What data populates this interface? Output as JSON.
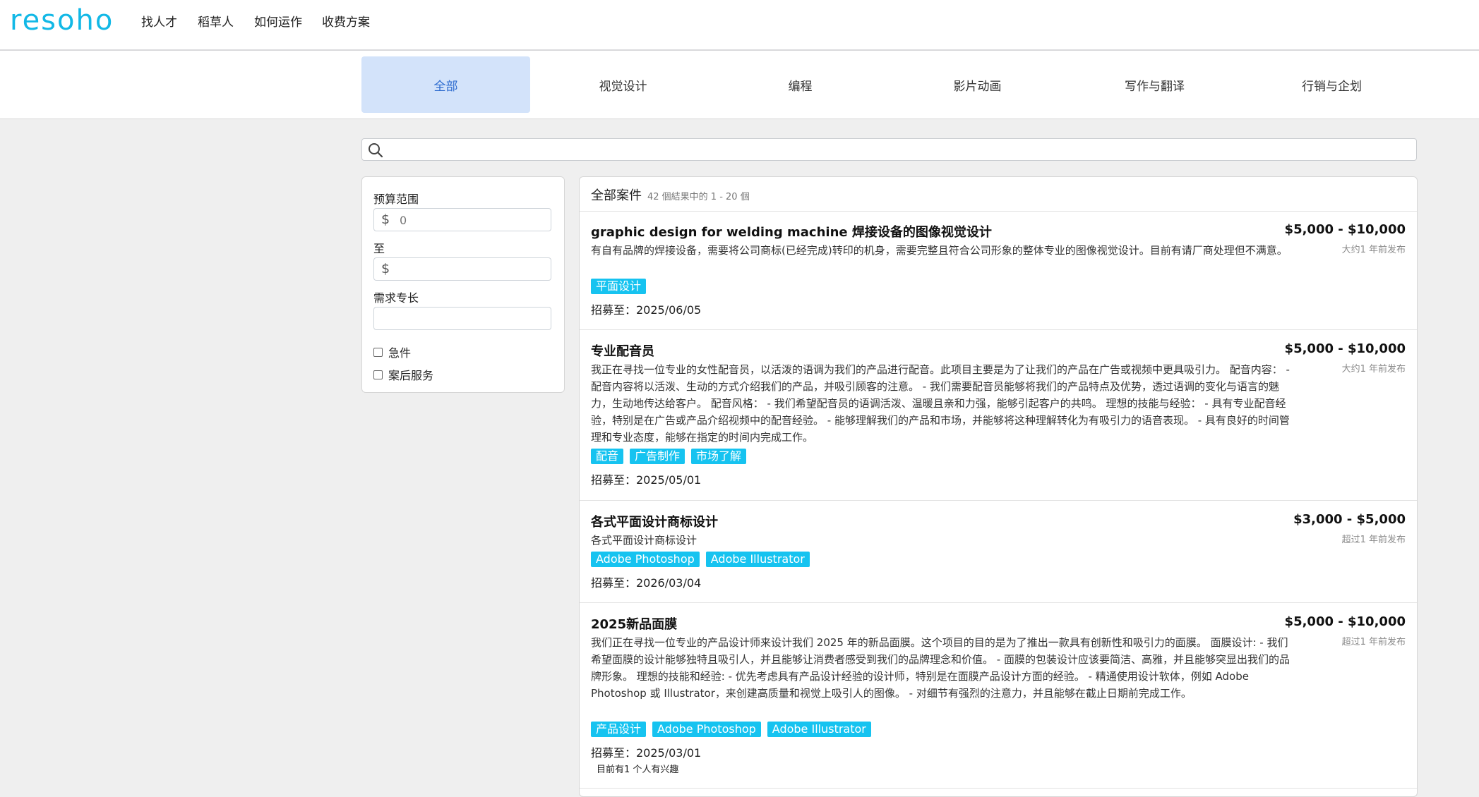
{
  "nav": {
    "logo": "resoho",
    "links": [
      "找人才",
      "稻草人",
      "如何运作",
      "收费方案"
    ]
  },
  "categories": [
    "全部",
    "视觉设计",
    "编程",
    "影片动画",
    "写作与翻译",
    "行销与企划"
  ],
  "search": {
    "placeholder": "",
    "value": ""
  },
  "filter": {
    "budget_label": "预算范围",
    "min_placeholder": "0",
    "to_label": "至",
    "max_placeholder": "",
    "skill_label": "需求专长",
    "skill_value": "",
    "urgent_label": "急件",
    "aftersale_label": "案后服务"
  },
  "results": {
    "title": "全部案件",
    "count_text": "42 個結果中的 1 - 20 個",
    "items": [
      {
        "title": "graphic design for welding machine 焊接设备的图像视觉设计",
        "description": "有自有品牌的焊接设备，需要将公司商标(已经完成)转印的机身，需要完整且符合公司形象的整体专业的图像视觉设计。目前有请厂商处理但不满意。",
        "tags": [
          "平面设计"
        ],
        "deadline": "招募至：2025/06/05",
        "price": "$5,000 - $10,000",
        "posted": "大约1 年前发布",
        "interest": ""
      },
      {
        "title": "专业配音员",
        "description": "我正在寻找一位专业的女性配音员，以活泼的语调为我们的产品进行配音。此项目主要是为了让我们的产品在广告或视频中更具吸引力。 配音内容： - 配音内容将以活泼、生动的方式介绍我们的产品，并吸引顾客的注意。 - 我们需要配音员能够将我们的产品特点及优势，透过语调的变化与语言的魅力，生动地传达给客户。 配音风格： - 我们希望配音员的语调活泼、温暖且亲和力强，能够引起客户的共鸣。 理想的技能与经验： - 具有专业配音经验，特别是在广告或产品介绍视频中的配音经验。 - 能够理解我们的产品和市场，并能够将这种理解转化为有吸引力的语音表现。 - 具有良好的时间管理和专业态度，能够在指定的时间内完成工作。",
        "tags": [
          "配音",
          "广告制作",
          "市场了解"
        ],
        "deadline": "招募至：2025/05/01",
        "price": "$5,000 - $10,000",
        "posted": "大约1 年前发布",
        "interest": ""
      },
      {
        "title": "各式平面设计商标设计",
        "description": "各式平面设计商标设计",
        "tags": [
          "Adobe Photoshop",
          "Adobe Illustrator"
        ],
        "deadline": "招募至：2026/03/04",
        "price": "$3,000 - $5,000",
        "posted": "超过1 年前发布",
        "interest": ""
      },
      {
        "title": "2025新品面膜",
        "description": "我们正在寻找一位专业的产品设计师来设计我们 2025 年的新品面膜。这个项目的目的是为了推出一款具有创新性和吸引力的面膜。 面膜设计: - 我们希望面膜的设计能够独特且吸引人，并且能够让消费者感受到我们的品牌理念和价值。 - 面膜的包装设计应该要简洁、高雅，并且能够突显出我们的品牌形象。 理想的技能和经验: - 优先考虑具有产品设计经验的设计师，特别是在面膜产品设计方面的经验。 - 精通使用设计软体，例如 Adobe Photoshop 或 Illustrator，来创建高质量和视觉上吸引人的图像。 - 对细节有强烈的注意力，并且能够在截止日期前完成工作。",
        "tags": [
          "产品设计",
          "Adobe Photoshop",
          "Adobe Illustrator"
        ],
        "deadline": "招募至：2025/03/01",
        "price": "$5,000 - $10,000",
        "posted": "超过1 年前发布",
        "interest": "目前有1 个人有兴趣"
      }
    ]
  },
  "colors": {
    "accent": "#16c3f0",
    "logo": "#12b8e6",
    "active_tab_bg": "#d3e3fa",
    "active_tab_text": "#2c6bcf"
  },
  "icons": {
    "search": "search-icon",
    "dollar": "dollar-icon"
  }
}
